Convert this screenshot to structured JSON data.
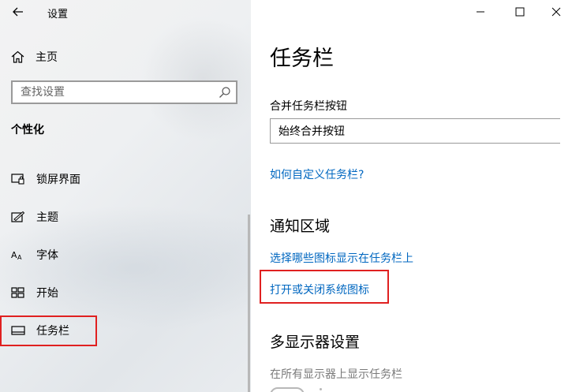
{
  "window": {
    "title": "设置"
  },
  "sidebar": {
    "home_label": "主页",
    "search_placeholder": "查找设置",
    "section": "个性化",
    "items": [
      {
        "label": "锁屏界面",
        "icon": "lock-screen-icon"
      },
      {
        "label": "主题",
        "icon": "theme-icon"
      },
      {
        "label": "字体",
        "icon": "font-icon"
      },
      {
        "label": "开始",
        "icon": "start-icon"
      },
      {
        "label": "任务栏",
        "icon": "taskbar-icon",
        "selected": true
      }
    ]
  },
  "main": {
    "title": "任务栏",
    "combine_label": "合并任务栏按钮",
    "combine_value": "始终合并按钮",
    "customize_link": "如何自定义任务栏?",
    "notification_title": "通知区域",
    "select_icons_link": "选择哪些图标显示在任务栏上",
    "system_icons_link": "打开或关闭系统图标",
    "multi_display_title": "多显示器设置",
    "show_all_displays_label": "在所有显示器上显示任务栏"
  },
  "colors": {
    "accent": "#0067c0",
    "highlight": "#e02020"
  }
}
